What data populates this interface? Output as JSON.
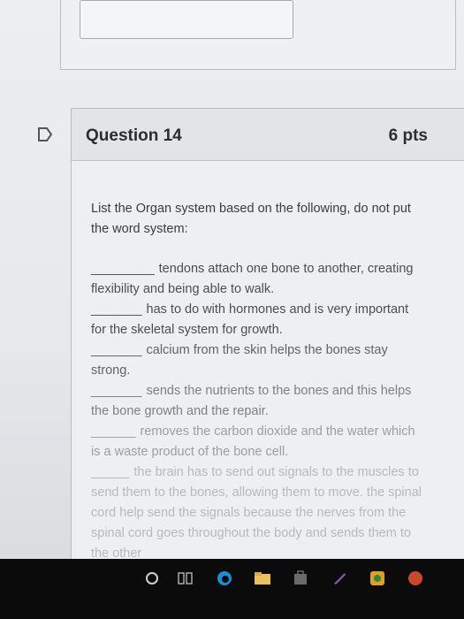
{
  "question": {
    "title": "Question 14",
    "points": "6 pts",
    "prompt": "List the Organ system based on the following, do not put the word system:",
    "items": [
      {
        "blank": "__________",
        "text": "tendons attach one bone to another, creating flexibility and being able to walk."
      },
      {
        "blank": "________",
        "text": "has to do with hormones and is very important for the skeletal system for growth."
      },
      {
        "blank": "________",
        "text": "calcium from the skin helps the bones stay strong."
      },
      {
        "blank": "________",
        "text": "sends the nutrients to the bones and this helps the bone growth and the repair."
      },
      {
        "blank": "_______",
        "text": "removes the carbon dioxide and the water which is a waste product of the bone cell."
      },
      {
        "blank": "______",
        "text": "the brain has to send out signals to the muscles to send them to the bones, allowing them to move. the spinal cord help send the signals because the nerves from the spinal cord goes throughout the body and sends them to the other"
      }
    ]
  },
  "icons": {
    "flag": "flag-icon",
    "taskbar": [
      "start-circle-icon",
      "task-view-icon",
      "edge-icon",
      "file-explorer-icon",
      "store-icon",
      "paint-icon",
      "app-icon"
    ]
  },
  "colors": {
    "text": "#3a3c3f",
    "header_bg": "#e2e4e6",
    "taskbar": "#0b0b0c"
  }
}
